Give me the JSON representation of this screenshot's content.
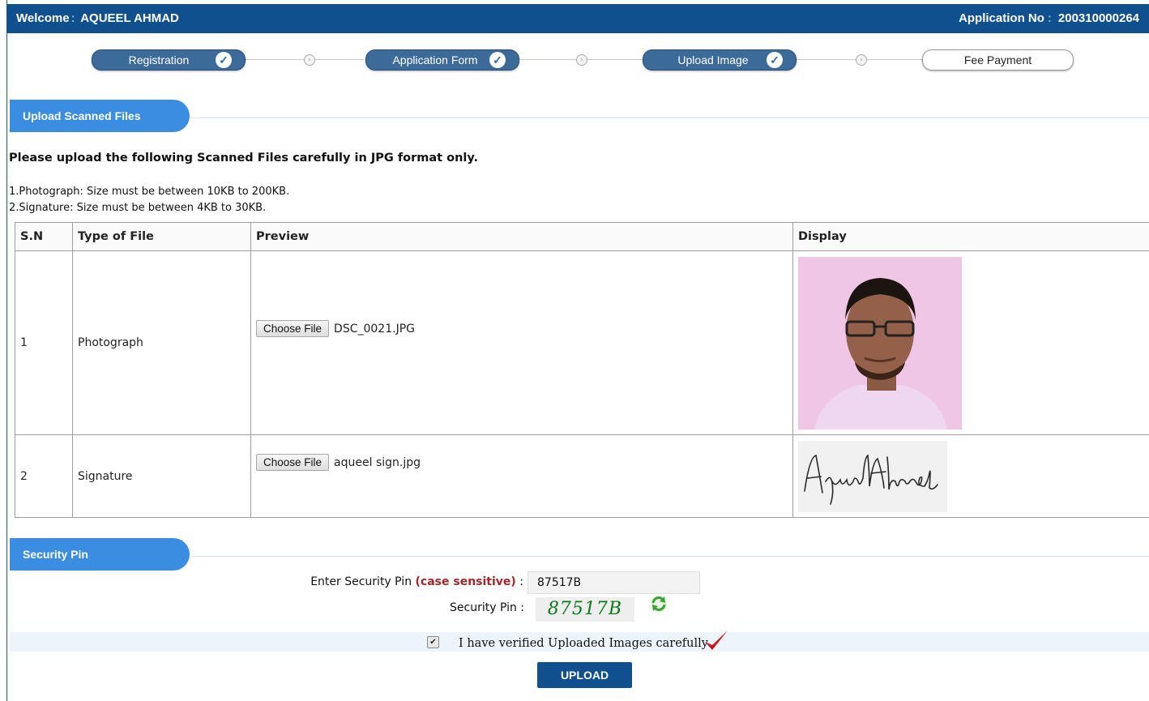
{
  "header": {
    "welcome_label": "Welcome",
    "user_name": "AQUEEL AHMAD",
    "app_no_label": "Application No",
    "app_no_value": "200310000264"
  },
  "steps": [
    {
      "label": "Registration",
      "done": true
    },
    {
      "label": "Application Form",
      "done": true
    },
    {
      "label": "Upload Image",
      "done": true
    },
    {
      "label": "Fee Payment",
      "done": false
    }
  ],
  "upload_section": {
    "title": "Upload Scanned Files",
    "instruction": "Please upload the following Scanned Files carefully in JPG format only.",
    "rule_1": "1.Photograph: Size must be between 10KB to 200KB.",
    "rule_2": "2.Signature: Size must be between 4KB to 30KB."
  },
  "table": {
    "headers": [
      "S.N",
      "Type of File",
      "Preview",
      "Display"
    ],
    "rows": [
      {
        "sn": "1",
        "type": "Photograph",
        "button": "Choose File",
        "file": "DSC_0021.JPG"
      },
      {
        "sn": "2",
        "type": "Signature",
        "button": "Choose File",
        "file": "aqueel sign.jpg"
      }
    ]
  },
  "security": {
    "title": "Security Pin",
    "enter_label": "Enter Security Pin",
    "case_note": "(case sensitive)",
    "colon": ":",
    "input_value": "87517B",
    "pin_label": "Security Pin :",
    "captcha": "87517B"
  },
  "verify": {
    "label": "I have verified Uploaded Images carefully",
    "checked": true
  },
  "upload_button": "UPLOAD",
  "colors": {
    "header": "#11508f",
    "section_tab": "#3b8de2",
    "step_done": "#3c6a99",
    "case_note": "#a0282b",
    "captcha": "#0b7a1b"
  }
}
